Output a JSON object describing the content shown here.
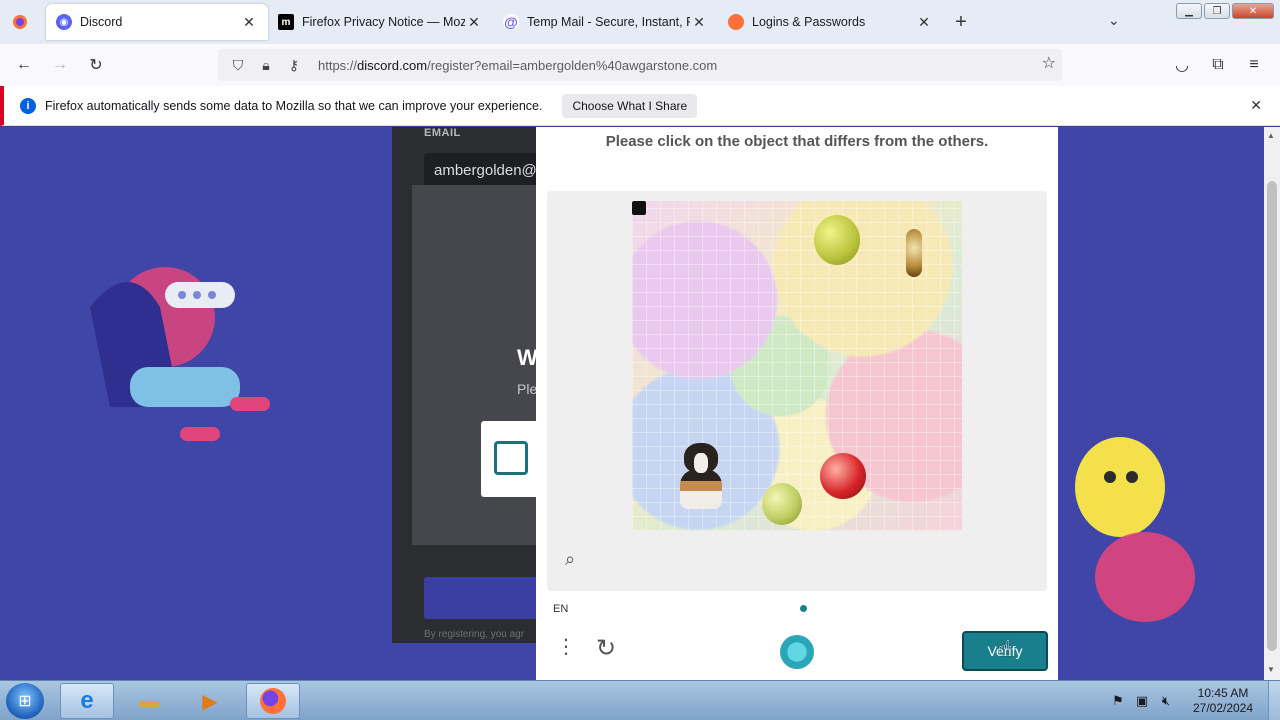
{
  "browser": {
    "tabs": [
      {
        "title": "Discord",
        "favicon": "discord-icon",
        "color": "#5865f2",
        "active": true
      },
      {
        "title": "Firefox Privacy Notice — Mozilla",
        "favicon": "mozilla-icon",
        "color": "#000000",
        "active": false
      },
      {
        "title": "Temp Mail - Secure, Instant, Fast",
        "favicon": "tempmail-icon",
        "color": "#6b5be6",
        "active": false
      },
      {
        "title": "Logins & Passwords",
        "favicon": "firefox-icon",
        "color": "#ff7139",
        "active": false
      }
    ],
    "url_prefix": "https://",
    "url_domain": "discord.com",
    "url_path": "/register?email=ambergolden%40awgarstone.com"
  },
  "notification": {
    "message": "Firefox automatically sends some data to Mozilla so that we can improve your experience.",
    "button": "Choose What I Share"
  },
  "register": {
    "email_label": "EMAIL",
    "email_value": "ambergolden@",
    "heading_partial": "W",
    "subheading_partial": "Ple",
    "terms_partial": "By registering, you agr"
  },
  "captcha": {
    "prompt": "Please click on the object that differs from the others.",
    "language": "EN",
    "verify_label": "Verify",
    "accent_color": "#1a7f8c"
  },
  "taskbar": {
    "time": "10:45 AM",
    "date": "27/02/2024"
  }
}
